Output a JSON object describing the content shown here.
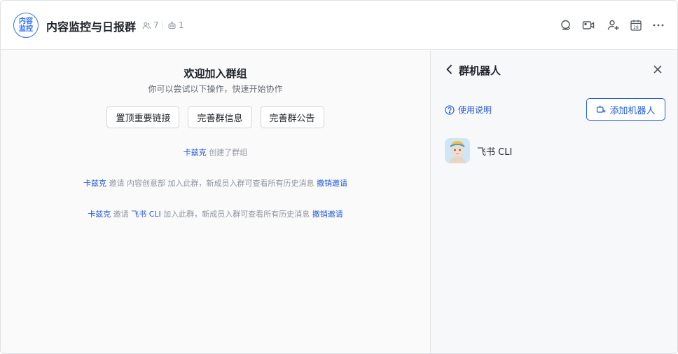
{
  "header": {
    "avatar_text": "内容监控",
    "title": "内容监控与日报群",
    "member_count": "7",
    "bot_count": "1",
    "icons": [
      "search-chat-icon",
      "video-call-icon",
      "add-member-icon",
      "calendar-icon",
      "more-icon"
    ],
    "calendar_day": "28"
  },
  "chat": {
    "welcome_title": "欢迎加入群组",
    "welcome_subtitle": "你可以尝试以下操作，快速开始协作",
    "actions": [
      "置顶重要链接",
      "完善群信息",
      "完善群公告"
    ],
    "messages": [
      {
        "user": "卡兹克",
        "text": "创建了群组"
      },
      {
        "user": "卡兹克",
        "verb": "邀请",
        "target": "内容创意部",
        "text": "加入此群，新成员入群可查看所有历史消息",
        "action": "撤销邀请"
      },
      {
        "user": "卡兹克",
        "verb": "邀请",
        "target": "飞书 CLI",
        "text": "加入此群，新成员入群可查看所有历史消息",
        "action": "撤销邀请"
      }
    ]
  },
  "panel": {
    "title": "群机器人",
    "help_label": "使用说明",
    "add_bot_label": "添加机器人",
    "bots": [
      {
        "name": "飞书 CLI"
      }
    ]
  },
  "colors": {
    "accent": "#245bdb",
    "avatar_border": "#3370ff",
    "muted": "#8f959e"
  }
}
